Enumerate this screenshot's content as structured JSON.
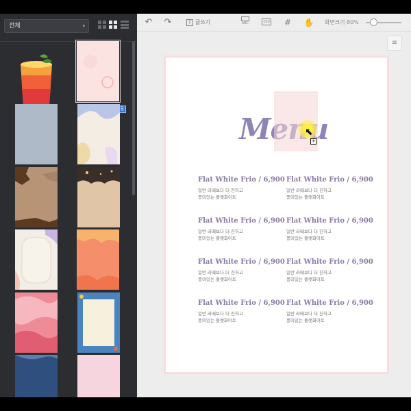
{
  "left_panel": {
    "category_select": {
      "value": "전체",
      "caret": "▾"
    },
    "view_modes": [
      "grid-large",
      "grid-small",
      "list"
    ],
    "thumbnails": [
      "drink",
      "pink-circle",
      "blue-gray",
      "pastel-shapes",
      "brown-paper",
      "night-sky",
      "blob-frame",
      "orange-coral",
      "pink-waves",
      "blue-frame",
      "navy-waves",
      "pink-scene"
    ],
    "selected_badge": "⎘"
  },
  "toolbar": {
    "undo": "↶",
    "redo": "↷",
    "text_tool_icon": "T",
    "text_tool_label": "글쓰기",
    "abc_label": "ABC",
    "hundred_label": "100",
    "grid_icon": "#",
    "hand_icon": "✋",
    "zoom_label": "화면크기 80%",
    "zoom_level": 0.1
  },
  "canvas": {
    "settings_icon": "≡",
    "menu_title": "Menu",
    "cursor": "⬉",
    "cursor_plus": "+",
    "items": [
      {
        "title": "Flat White Frio / 6,900",
        "desc1": "일반 라떼보다 더 진하고",
        "desc2": "풍미있는 플랫화이트"
      },
      {
        "title": "Flat White Frio / 6,900",
        "desc1": "일반 라떼보다 더 진하고",
        "desc2": "풍미있는 플랫화이트"
      },
      {
        "title": "Flat White Frio / 6,900",
        "desc1": "일반 라떼보다 더 진하고",
        "desc2": "풍미있는 플랫화이트"
      },
      {
        "title": "Flat White Frio / 6,900",
        "desc1": "일반 라떼보다 더 진하고",
        "desc2": "풍미있는 플랫화이트"
      },
      {
        "title": "Flat White Frio / 6,900",
        "desc1": "일반 라떼보다 더 진하고",
        "desc2": "풍미있는 플랫화이트"
      },
      {
        "title": "Flat White Frio / 6,900",
        "desc1": "일반 라떼보다 더 진하고",
        "desc2": "풍미있는 플랫화이트"
      },
      {
        "title": "Flat White Frio / 6,900",
        "desc1": "일반 라떼보다 더 진하고",
        "desc2": "풍미있는 플랫화이트"
      },
      {
        "title": "Flat White Frio / 6,900",
        "desc1": "일반 라떼보다 더 진하고",
        "desc2": "풍미있는 플랫화이트"
      }
    ]
  },
  "colors": {
    "panel_bg": "#2c2d31",
    "canvas_bg": "#ededed",
    "page_border": "#f8dcde",
    "title_color": "#8c85b8",
    "item_title_color": "#8a7ba4",
    "selection_badge": "#2b72d6"
  }
}
